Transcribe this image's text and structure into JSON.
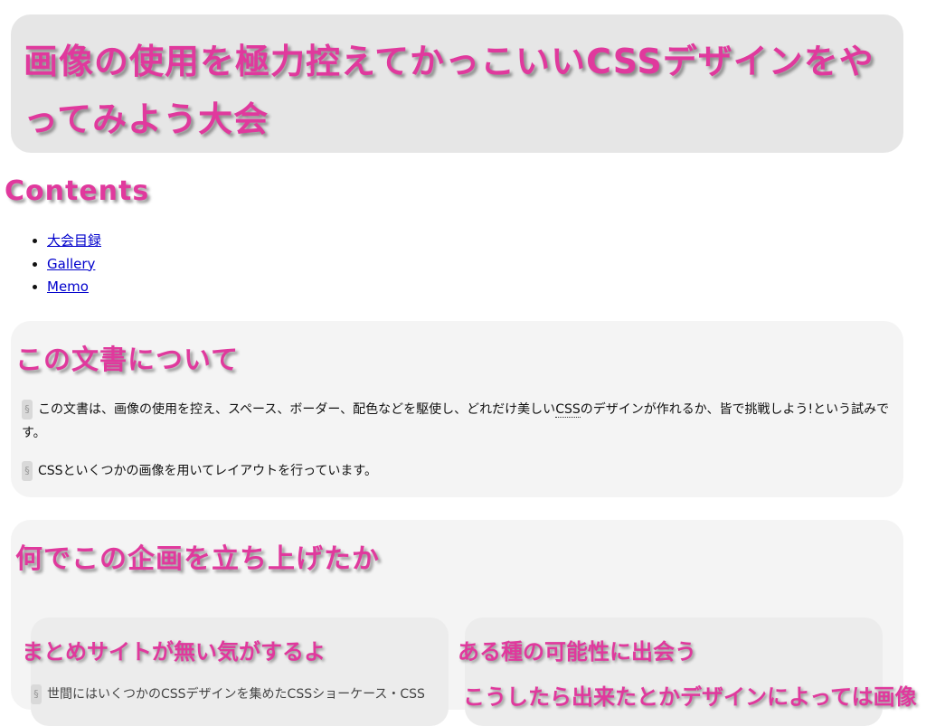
{
  "header": {
    "title": "画像の使用を極力控えてかっこいいCSSデザインをやってみよう大会"
  },
  "toc": {
    "title": "Contents",
    "items": [
      "大会目録",
      "Gallery",
      "Memo"
    ]
  },
  "about": {
    "title": "この文書について",
    "section_mark": "§",
    "p1_before": "この文書は、画像の使用を控え、スペース、ボーダー、配色などを駆使し、どれだけ美しい",
    "p1_abbr": "CSS",
    "p1_after": "のデザインが作れるか、皆で挑戦しよう!という試みです。",
    "p2": "CSSといくつかの画像を用いてレイアウトを行っています。"
  },
  "why": {
    "title": "何でこの企画を立ち上げたか",
    "col1_title": "まとめサイトが無い気がするよ",
    "col1_text": "世間にはいくつかのCSSデザインを集めたCSSショーケース・CSS",
    "col2_title": "ある種の可能性に出会う",
    "col2_text": "こうしたら出来たとかデザインによっては画像"
  }
}
